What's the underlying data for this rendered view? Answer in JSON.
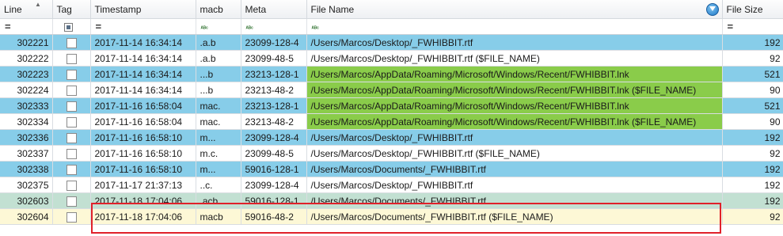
{
  "columns": {
    "line": "Line",
    "tag": "Tag",
    "timestamp": "Timestamp",
    "macb": "macb",
    "meta": "Meta",
    "file_name": "File Name",
    "file_size": "File Size"
  },
  "filter_row": {
    "equals_symbol": "=",
    "text_filter_glyph": "ᴬᴮᶜ"
  },
  "rows": [
    {
      "line": "302221",
      "timestamp": "2017-11-14 16:34:14",
      "macb": ".a.b",
      "meta": "23099-128-4",
      "file_name": "/Users/Marcos/Desktop/_FWHIBBIT.rtf",
      "file_size": "192"
    },
    {
      "line": "302222",
      "timestamp": "2017-11-14 16:34:14",
      "macb": ".a.b",
      "meta": "23099-48-5",
      "file_name": "/Users/Marcos/Desktop/_FWHIBBIT.rtf ($FILE_NAME)",
      "file_size": "92"
    },
    {
      "line": "302223",
      "timestamp": "2017-11-14 16:34:14",
      "macb": "...b",
      "meta": "23213-128-1",
      "file_name": "/Users/Marcos/AppData/Roaming/Microsoft/Windows/Recent/FWHIBBIT.lnk",
      "file_size": "521"
    },
    {
      "line": "302224",
      "timestamp": "2017-11-14 16:34:14",
      "macb": "...b",
      "meta": "23213-48-2",
      "file_name": "/Users/Marcos/AppData/Roaming/Microsoft/Windows/Recent/FWHIBBIT.lnk ($FILE_NAME)",
      "file_size": "90"
    },
    {
      "line": "302333",
      "timestamp": "2017-11-16 16:58:04",
      "macb": "mac.",
      "meta": "23213-128-1",
      "file_name": "/Users/Marcos/AppData/Roaming/Microsoft/Windows/Recent/FWHIBBIT.lnk",
      "file_size": "521"
    },
    {
      "line": "302334",
      "timestamp": "2017-11-16 16:58:04",
      "macb": "mac.",
      "meta": "23213-48-2",
      "file_name": "/Users/Marcos/AppData/Roaming/Microsoft/Windows/Recent/FWHIBBIT.lnk ($FILE_NAME)",
      "file_size": "90"
    },
    {
      "line": "302336",
      "timestamp": "2017-11-16 16:58:10",
      "macb": "m...",
      "meta": "23099-128-4",
      "file_name": "/Users/Marcos/Desktop/_FWHIBBIT.rtf",
      "file_size": "192"
    },
    {
      "line": "302337",
      "timestamp": "2017-11-16 16:58:10",
      "macb": "m.c.",
      "meta": "23099-48-5",
      "file_name": "/Users/Marcos/Desktop/_FWHIBBIT.rtf ($FILE_NAME)",
      "file_size": "92"
    },
    {
      "line": "302338",
      "timestamp": "2017-11-16 16:58:10",
      "macb": "m...",
      "meta": "59016-128-1",
      "file_name": "/Users/Marcos/Documents/_FWHIBBIT.rtf",
      "file_size": "192"
    },
    {
      "line": "302375",
      "timestamp": "2017-11-17 21:37:13",
      "macb": "..c.",
      "meta": "23099-128-4",
      "file_name": "/Users/Marcos/Desktop/_FWHIBBIT.rtf",
      "file_size": "192"
    },
    {
      "line": "302603",
      "timestamp": "2017-11-18 17:04:06",
      "macb": ".acb",
      "meta": "59016-128-1",
      "file_name": "/Users/Marcos/Documents/_FWHIBBIT.rtf",
      "file_size": "192"
    },
    {
      "line": "302604",
      "timestamp": "2017-11-18 17:04:06",
      "macb": "macb",
      "meta": "59016-48-2",
      "file_name": "/Users/Marcos/Documents/_FWHIBBIT.rtf ($FILE_NAME)",
      "file_size": "92"
    }
  ],
  "colors": {
    "row_blue": "#87cde9",
    "row_white": "#ffffff",
    "filename_green": "#8acc4a",
    "selected_green": "#c2e0d2",
    "selected_yellow": "#fdf8d6",
    "highlight_red": "#e0212a"
  },
  "icons": {
    "sort": "sort-ascending-icon",
    "filter": "filter-funnel-icon"
  }
}
